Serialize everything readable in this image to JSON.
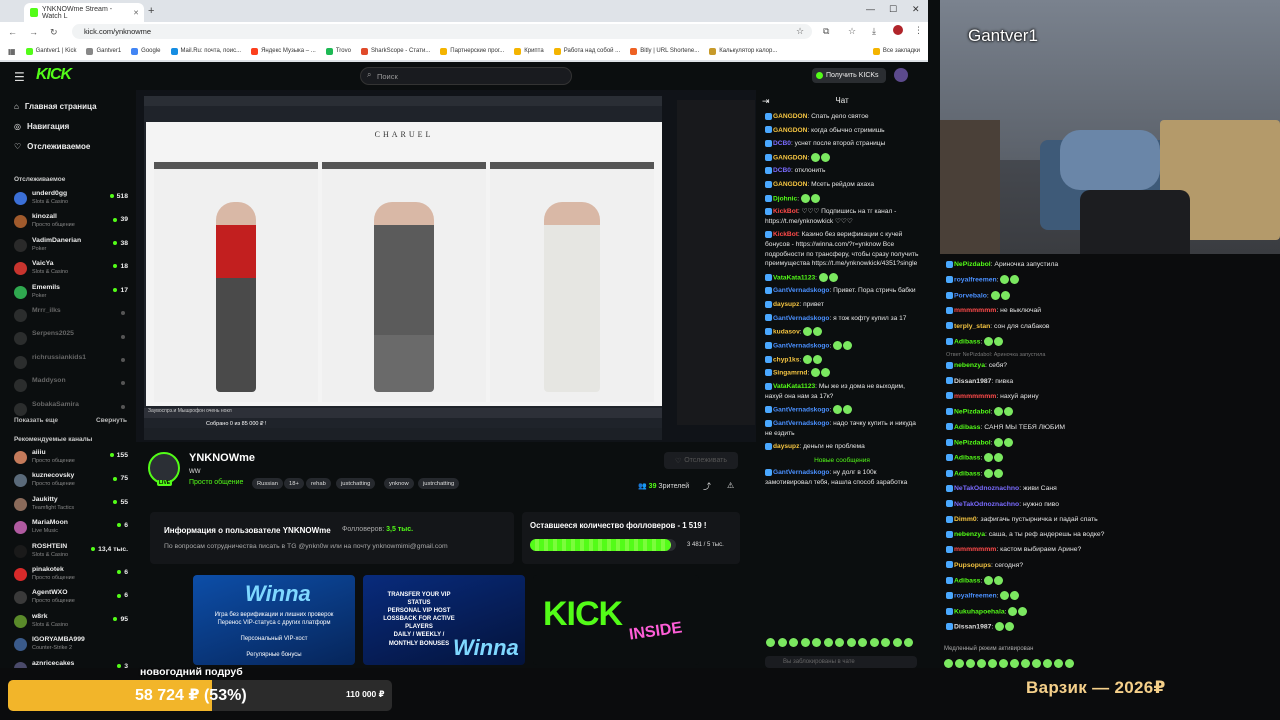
{
  "browser": {
    "tab_title": "YNKNOWme Stream - Watch L",
    "url": "kick.com/ynknowme",
    "bookmarks": [
      "Gantver1 | Kick",
      "Gantver1",
      "Google",
      "Mail.Ru: почта, поис...",
      "Яндекс Музыка – ...",
      "Trovo",
      "SharkScope - Стати...",
      "Партнерские прог...",
      "Крипта",
      "Работа над собой ...",
      "Bitly | URL Shortene...",
      "Калькулятор калор..."
    ],
    "all_bookmarks": "Все закладки"
  },
  "header": {
    "logo": "KICK",
    "search_placeholder": "Поиск",
    "get_kicks": "Получить KICKs"
  },
  "sidebar": {
    "nav": [
      {
        "label": "Главная страница",
        "icon": "home-icon"
      },
      {
        "label": "Навигация",
        "icon": "compass-icon"
      },
      {
        "label": "Отслеживаемое",
        "icon": "heart-icon"
      }
    ],
    "following_title": "Отслеживаемое",
    "following": [
      {
        "name": "underd0gg",
        "category": "Slots & Casino",
        "count": "518",
        "color": "#3b6fd6"
      },
      {
        "name": "kinozall",
        "category": "Просто общение",
        "count": "39",
        "color": "#a05a2c"
      },
      {
        "name": "VadimDanerian",
        "category": "Poker",
        "count": "38",
        "color": "#2a2a2a"
      },
      {
        "name": "VaicYa",
        "category": "Slots & Casino",
        "count": "18",
        "color": "#c8342e"
      },
      {
        "name": "Ememils",
        "category": "Poker",
        "count": "17",
        "color": "#2fa84f"
      },
      {
        "name": "Mrrr_ilks",
        "category": "",
        "count": "",
        "color": "#666666",
        "offline": true
      },
      {
        "name": "Serpens2025",
        "category": "",
        "count": "",
        "color": "#666666",
        "offline": true
      },
      {
        "name": "richrussiankids1",
        "category": "",
        "count": "",
        "color": "#666666",
        "offline": true
      },
      {
        "name": "Maddyson",
        "category": "",
        "count": "",
        "color": "#666666",
        "offline": true
      },
      {
        "name": "SobakaSamira",
        "category": "",
        "count": "",
        "color": "#666666",
        "offline": true
      }
    ],
    "show_more": "Показать еще",
    "collapse": "Свернуть",
    "recommended_title": "Рекомендуемые каналы",
    "recommended": [
      {
        "name": "aiiiu",
        "category": "Просто общение",
        "count": "155",
        "color": "#c47a5a"
      },
      {
        "name": "kuznecovsky",
        "category": "Просто общение",
        "count": "75",
        "color": "#5a6a7a"
      },
      {
        "name": "Jaukitty",
        "category": "Teamfight Tactics",
        "count": "55",
        "color": "#8a6a5a"
      },
      {
        "name": "MariaMoon",
        "category": "Live Music",
        "count": "6",
        "color": "#b05aa0"
      },
      {
        "name": "ROSHTEIN",
        "category": "Slots & Casino",
        "count": "13,4 тыс.",
        "color": "#1a1a1a"
      },
      {
        "name": "pinakotek",
        "category": "Просто общение",
        "count": "6",
        "color": "#d82a2a"
      },
      {
        "name": "AgentWXO",
        "category": "Просто общение",
        "count": "6",
        "color": "#3a3a3a"
      },
      {
        "name": "w8rk",
        "category": "Slots & Casino",
        "count": "95",
        "color": "#5a8a2a"
      },
      {
        "name": "IGORYAMBA999",
        "category": "Counter-Strike 2",
        "count": "",
        "color": "#3a5a8a"
      },
      {
        "name": "aznricecakes",
        "category": "EA Sports College",
        "count": "3",
        "color": "#4a4a6a"
      }
    ]
  },
  "video": {
    "brand": "CHARUEL",
    "caption": "Заувоспрэ.и Мышрофон очень нокл",
    "collected": "Собрано 0 из 85 000 ₽ !"
  },
  "stream": {
    "name": "YNKNOWme",
    "subtitle": "ww",
    "category": "Просто общение",
    "tags": [
      "Russian",
      "18+",
      "rehab",
      "justchatting",
      "ynknow",
      "justrchatting"
    ],
    "follow_label": "Отслеживать",
    "viewers_count": "39",
    "viewers_label": "Зрителей"
  },
  "about": {
    "title": "Информация о пользователе YNKNOWme",
    "followers_label": "Фолловеров:",
    "followers_value": "3,5 тыс.",
    "text": "По вопросам сотрудничества писать в TG @ynkn0w или на почту ynknowmimi@gmail.com"
  },
  "goal": {
    "title": "Оставшееся количество фолловеров - 1 519 !",
    "progress": "3 481 / 5 тыс.",
    "fraction": 0.696
  },
  "panels": {
    "p1_title": "Winna",
    "p1_text": [
      "Игра без верификации и лишних проверок",
      "Перенос VIP-статуса с других платформ",
      "Персональный VIP-хост",
      "Регулярные бонусы"
    ],
    "p2_text": [
      "TRANSFER YOUR VIP",
      "STATUS",
      "PERSONAL VIP HOST",
      "LOSSBACK FOR ACTIVE",
      "PLAYERS",
      "DAILY / WEEKLY /",
      "MONTHLY BONUSES"
    ],
    "p2_logo": "Winna",
    "p3_logo": "KICK",
    "p3_sub": "INSIDE"
  },
  "chat": {
    "title": "Чат",
    "new_messages": "Новые сообщения",
    "input_placeholder": "Вы заблокированы в чате",
    "messages": [
      {
        "user": "GANGDON",
        "color": "#f5c542",
        "text": "Спать дело святое"
      },
      {
        "user": "GANGDON",
        "color": "#f5c542",
        "text": "когда обычно стримишь"
      },
      {
        "user": "DCB0",
        "color": "#7a6bff",
        "text": "уснет после второй страницы"
      },
      {
        "user": "GANGDON",
        "color": "#f5c542",
        "text": ""
      },
      {
        "user": "DCB0",
        "color": "#7a6bff",
        "text": "отклонить"
      },
      {
        "user": "GANGDON",
        "color": "#f5c542",
        "text": "Мсеть рейдом ахаха"
      },
      {
        "user": "Djohnic",
        "color": "#53fc18",
        "text": ""
      },
      {
        "user": "KickBot",
        "color": "#ff4a4a",
        "text": "♡♡♡ Подпишись на тг канал - https://t.me/ynknowkick ♡♡♡"
      },
      {
        "user": "KickBot",
        "color": "#ff4a4a",
        "text": "Казино без верификации с кучей бонусов - https://winna.com/?r=ynknow Все подробности по трансферу, чтобы сразу получить преимущества https://t.me/ynknowkick/4351?single"
      },
      {
        "user": "VataKata1123",
        "color": "#53fc18",
        "text": ""
      },
      {
        "user": "GantVernadskogo",
        "color": "#4a90ff",
        "text": "Привет. Пора стричь бабки"
      },
      {
        "user": "daysupz",
        "color": "#f5c542",
        "text": "привет"
      },
      {
        "user": "GantVernadskogo",
        "color": "#4a90ff",
        "text": "я тож кофту купил за 17"
      },
      {
        "user": "kudasov",
        "color": "#f5c542",
        "text": ""
      },
      {
        "user": "GantVernadskogo",
        "color": "#4a90ff",
        "text": ""
      },
      {
        "user": "chyp1ks",
        "color": "#f5c542",
        "text": ""
      },
      {
        "user": "Singamrnd",
        "color": "#f5c542",
        "text": ""
      },
      {
        "user": "VataKata1123",
        "color": "#53fc18",
        "text": "Мы же из дома не выходим, нахуй она нам за 17к?"
      },
      {
        "user": "GantVernadskogo",
        "color": "#4a90ff",
        "text": ""
      },
      {
        "user": "GantVernadskogo",
        "color": "#4a90ff",
        "text": "надо тачку купить и никуда не ездить"
      },
      {
        "user": "daysupz",
        "color": "#f5c542",
        "text": "деньги не проблема"
      }
    ],
    "after_new": [
      {
        "user": "GantVernadskogo",
        "color": "#4a90ff",
        "text": "ну долг в 100к замотивировал тебя, нашла способ заработка"
      }
    ]
  },
  "webcam": {
    "name": "Gantver1"
  },
  "side_chat": {
    "messages": [
      {
        "user": "NePizdabol",
        "color": "#53fc18",
        "text": "Ариночка запустила"
      },
      {
        "user": "royalfreemen",
        "color": "#4a90ff",
        "text": ""
      },
      {
        "user": "Porvebalo",
        "color": "#4a90ff",
        "text": ""
      },
      {
        "user": "mmmmmmm",
        "color": "#ff4a4a",
        "text": "не выключай"
      },
      {
        "user": "terply_stan",
        "color": "#f5c542",
        "text": "сон для слабаков"
      },
      {
        "user": "Adibass",
        "color": "#53fc18",
        "text": ""
      },
      {
        "user": "nebenzya",
        "color": "#53fc18",
        "text": "себя?"
      },
      {
        "user": "Dissan1987",
        "color": "#ddd",
        "text": "пивка"
      },
      {
        "user": "mmmmmmm",
        "color": "#ff4a4a",
        "text": "нахуй арину"
      },
      {
        "user": "NePizdabol",
        "color": "#53fc18",
        "text": ""
      },
      {
        "user": "Adibass",
        "color": "#53fc18",
        "text": "САНЯ МЫ ТЕБЯ ЛЮБИМ"
      },
      {
        "user": "NePizdabol",
        "color": "#53fc18",
        "text": ""
      },
      {
        "user": "Adibass",
        "color": "#53fc18",
        "text": ""
      },
      {
        "user": "Adibass",
        "color": "#53fc18",
        "text": ""
      },
      {
        "user": "NeTakOdnoznachno",
        "color": "#7a6bff",
        "text": "живи Саня"
      },
      {
        "user": "NeTakOdnoznachno",
        "color": "#7a6bff",
        "text": "нужно пиво"
      },
      {
        "user": "Dimm0",
        "color": "#f5c542",
        "text": "зафигачь пустырничка и падай спать"
      },
      {
        "user": "nebenzya",
        "color": "#53fc18",
        "text": "саша, а ты реф андерешь на водке?"
      },
      {
        "user": "mmmmmmm",
        "color": "#ff4a4a",
        "text": "кастом выбираем Арине?"
      },
      {
        "user": "Pupsopups",
        "color": "#f5c542",
        "text": "сегодня?"
      },
      {
        "user": "Adibass",
        "color": "#53fc18",
        "text": ""
      },
      {
        "user": "royalfreemen",
        "color": "#4a90ff",
        "text": ""
      },
      {
        "user": "Kukuhapoehala",
        "color": "#53fc18",
        "text": ""
      },
      {
        "user": "Dissan1987",
        "color": "#ddd",
        "text": ""
      }
    ],
    "reply_note": "Ответ NePizdabol: Ариночка запустила",
    "slow_mode": "Медленный режим активирован"
  },
  "donation": {
    "label": "новогодний подруб",
    "current": "58 724 ₽ (53%)",
    "target": "110 000 ₽",
    "fraction": 0.53
  },
  "overlay": {
    "varzik": "Варзик — 2026₽"
  },
  "colors": {
    "kick_green": "#53fc18",
    "donation_gold": "#f2b52a"
  }
}
